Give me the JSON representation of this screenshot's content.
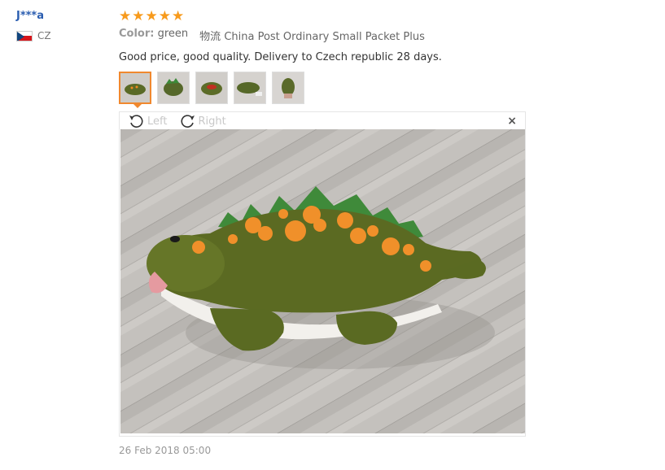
{
  "reviewer": {
    "name": "J***a",
    "country_code": "CZ"
  },
  "rating": {
    "stars": 5,
    "max": 5
  },
  "details": {
    "color_label": "Color:",
    "color_value": "green",
    "shipping_label": "物流",
    "shipping_value": "China Post Ordinary Small Packet Plus"
  },
  "review_text": "Good price, good quality. Delivery to Czech republic 28 days.",
  "viewer": {
    "rotate_left": "Left",
    "rotate_right": "Right",
    "close": "×"
  },
  "date": "26 Feb 2018 05:00",
  "colors": {
    "star": "#f79a1c",
    "accent": "#f0882e",
    "link": "#2a5db0"
  }
}
